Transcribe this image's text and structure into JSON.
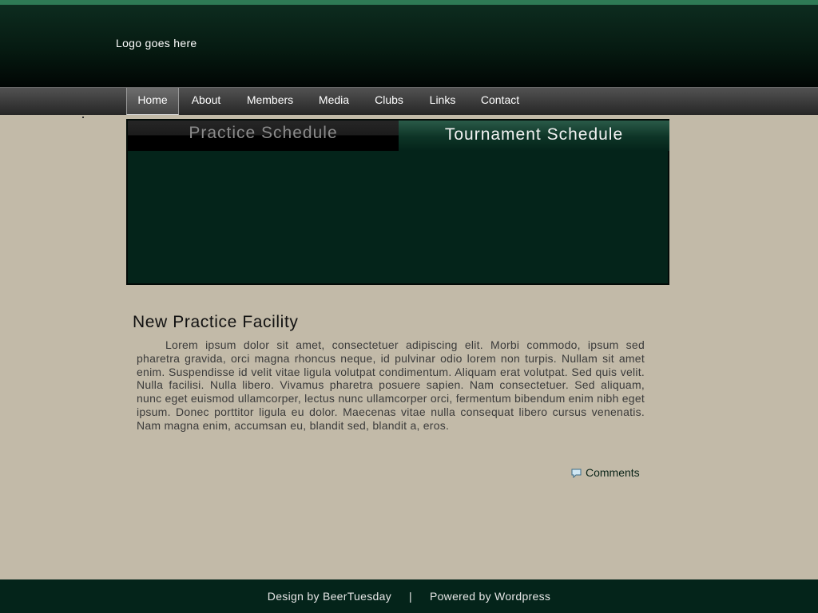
{
  "header": {
    "logo_text": "Logo goes here"
  },
  "nav": {
    "items": [
      {
        "label": "Home",
        "active": true
      },
      {
        "label": "About"
      },
      {
        "label": "Members"
      },
      {
        "label": "Media"
      },
      {
        "label": "Clubs"
      },
      {
        "label": "Links"
      },
      {
        "label": "Contact"
      }
    ]
  },
  "schedule": {
    "tabs": [
      {
        "label": "Practice Schedule"
      },
      {
        "label": "Tournament Schedule",
        "active": true
      }
    ]
  },
  "post": {
    "title": "New Practice Facility",
    "body": "Lorem ipsum dolor sit amet, consectetuer adipiscing elit. Morbi commodo, ipsum sed pharetra gravida, orci magna rhoncus neque, id pulvinar odio lorem non turpis. Nullam sit amet enim. Suspendisse id velit vitae ligula volutpat condimentum. Aliquam erat volutpat. Sed quis velit. Nulla facilisi. Nulla libero. Vivamus pharetra posuere sapien. Nam consectetuer. Sed aliquam, nunc eget euismod ullamcorper, lectus nunc ullamcorper orci, fermentum bibendum enim nibh eget ipsum. Donec porttitor ligula eu dolor. Maecenas vitae nulla consequat libero cursus venenatis. Nam magna enim, accumsan eu, blandit sed, blandit a, eros.",
    "comments_label": "Comments",
    "comments_icon": "speech-bubble-icon"
  },
  "footer": {
    "design_credit": "Design by BeerTuesday",
    "separator": "|",
    "powered_by": "Powered by Wordpress"
  },
  "colors": {
    "header_green": "#061a11",
    "top_stripe": "#2e7a55",
    "panel_green": "#04241a",
    "page_bg": "#c2baa8",
    "nav_grey": "#3c3c3c"
  }
}
